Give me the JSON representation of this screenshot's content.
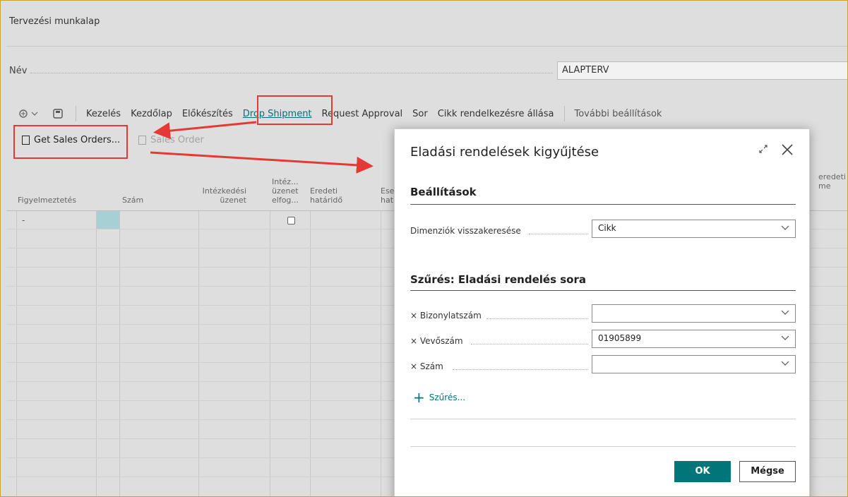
{
  "page": {
    "title": "Tervezési munkalap"
  },
  "name_field": {
    "label": "Név",
    "value": "ALAPTERV"
  },
  "actionbar": {
    "items": [
      "Kezelés",
      "Kezdőlap",
      "Előkészítés",
      "Drop Shipment",
      "Request Approval",
      "Sor",
      "Cikk rendelkezésre állása",
      "További beállítások"
    ]
  },
  "subbar": {
    "get_sales_orders": "Get Sales Orders...",
    "sales_order": "Sales Order"
  },
  "grid": {
    "columns": [
      {
        "label": "Figyelmeztetés"
      },
      {
        "label": "Szám"
      },
      {
        "label": "Intézkedési üzenet"
      },
      {
        "label": "Intéz... üzenet elfog..."
      },
      {
        "label": "Eredeti határidő"
      },
      {
        "label": "Ese hat"
      },
      {
        "label": "eredeti me"
      }
    ],
    "first_row_dash": "-"
  },
  "dialog": {
    "title": "Eladási rendelések kigyűjtése",
    "section_settings": "Beállítások",
    "dim_label": "Dimenziók visszakeresése",
    "dim_value": "Cikk",
    "section_filter": "Szűrés: Eladási rendelés sora",
    "filters": [
      {
        "label": "Bizonylatszám",
        "value": ""
      },
      {
        "label": "Vevőszám",
        "value": "01905899"
      },
      {
        "label": "Szám",
        "value": ""
      }
    ],
    "add_filter": "Szűrés...",
    "ok": "OK",
    "cancel": "Mégse"
  },
  "colors": {
    "accent": "#00757a",
    "annotation": "#e53935",
    "selected_cell": "#a6d0d4"
  },
  "icons": [
    "lightbulb-icon",
    "chevron-down-icon",
    "page-icon",
    "document-icon",
    "expand-icon",
    "close-icon",
    "plus-icon",
    "checkbox-icon"
  ]
}
